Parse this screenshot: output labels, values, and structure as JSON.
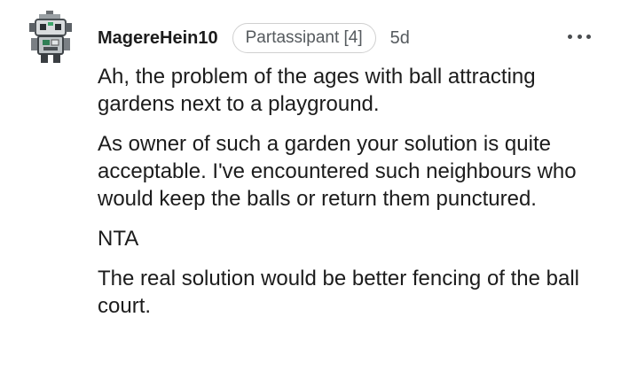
{
  "comment": {
    "username": "MagereHein10",
    "flair": "Partassipant [4]",
    "age": "5d",
    "avatar_icon": "robot-avatar-icon",
    "more_icon": "more-options-icon",
    "paragraphs": [
      "Ah, the problem of the ages with ball attracting gardens next to a playground.",
      "As owner of such a garden your solution is quite acceptable. I've encountered such neighbours who would keep the balls or return them punctured.",
      "NTA",
      "The real solution would be better fencing of the ball court."
    ]
  }
}
